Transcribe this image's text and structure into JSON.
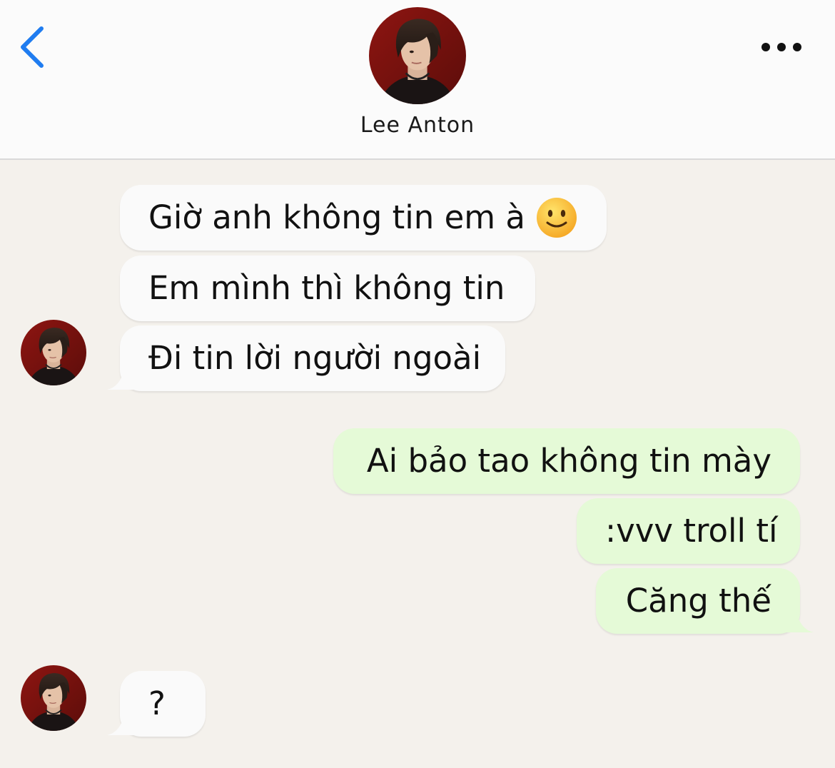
{
  "header": {
    "contact_name": "Lee Anton"
  },
  "colors": {
    "accent_blue": "#1f7cf0",
    "incoming_bubble": "#fafafa",
    "outgoing_bubble": "#e5fad7",
    "chat_background": "#f4f1ec"
  },
  "icons": {
    "back": "chevron-left-icon",
    "more": "ellipsis-icon",
    "emoji": "slightly-smiling-face-emoji"
  },
  "messages": {
    "m1": "Giờ anh không tin em à",
    "m2": "Em mình thì không tin",
    "m3": "Đi tin lời người ngoài",
    "m4": "Ai bảo tao không tin mày",
    "m5": ":vvv troll tí",
    "m6": "Căng thế",
    "m7": "?"
  }
}
